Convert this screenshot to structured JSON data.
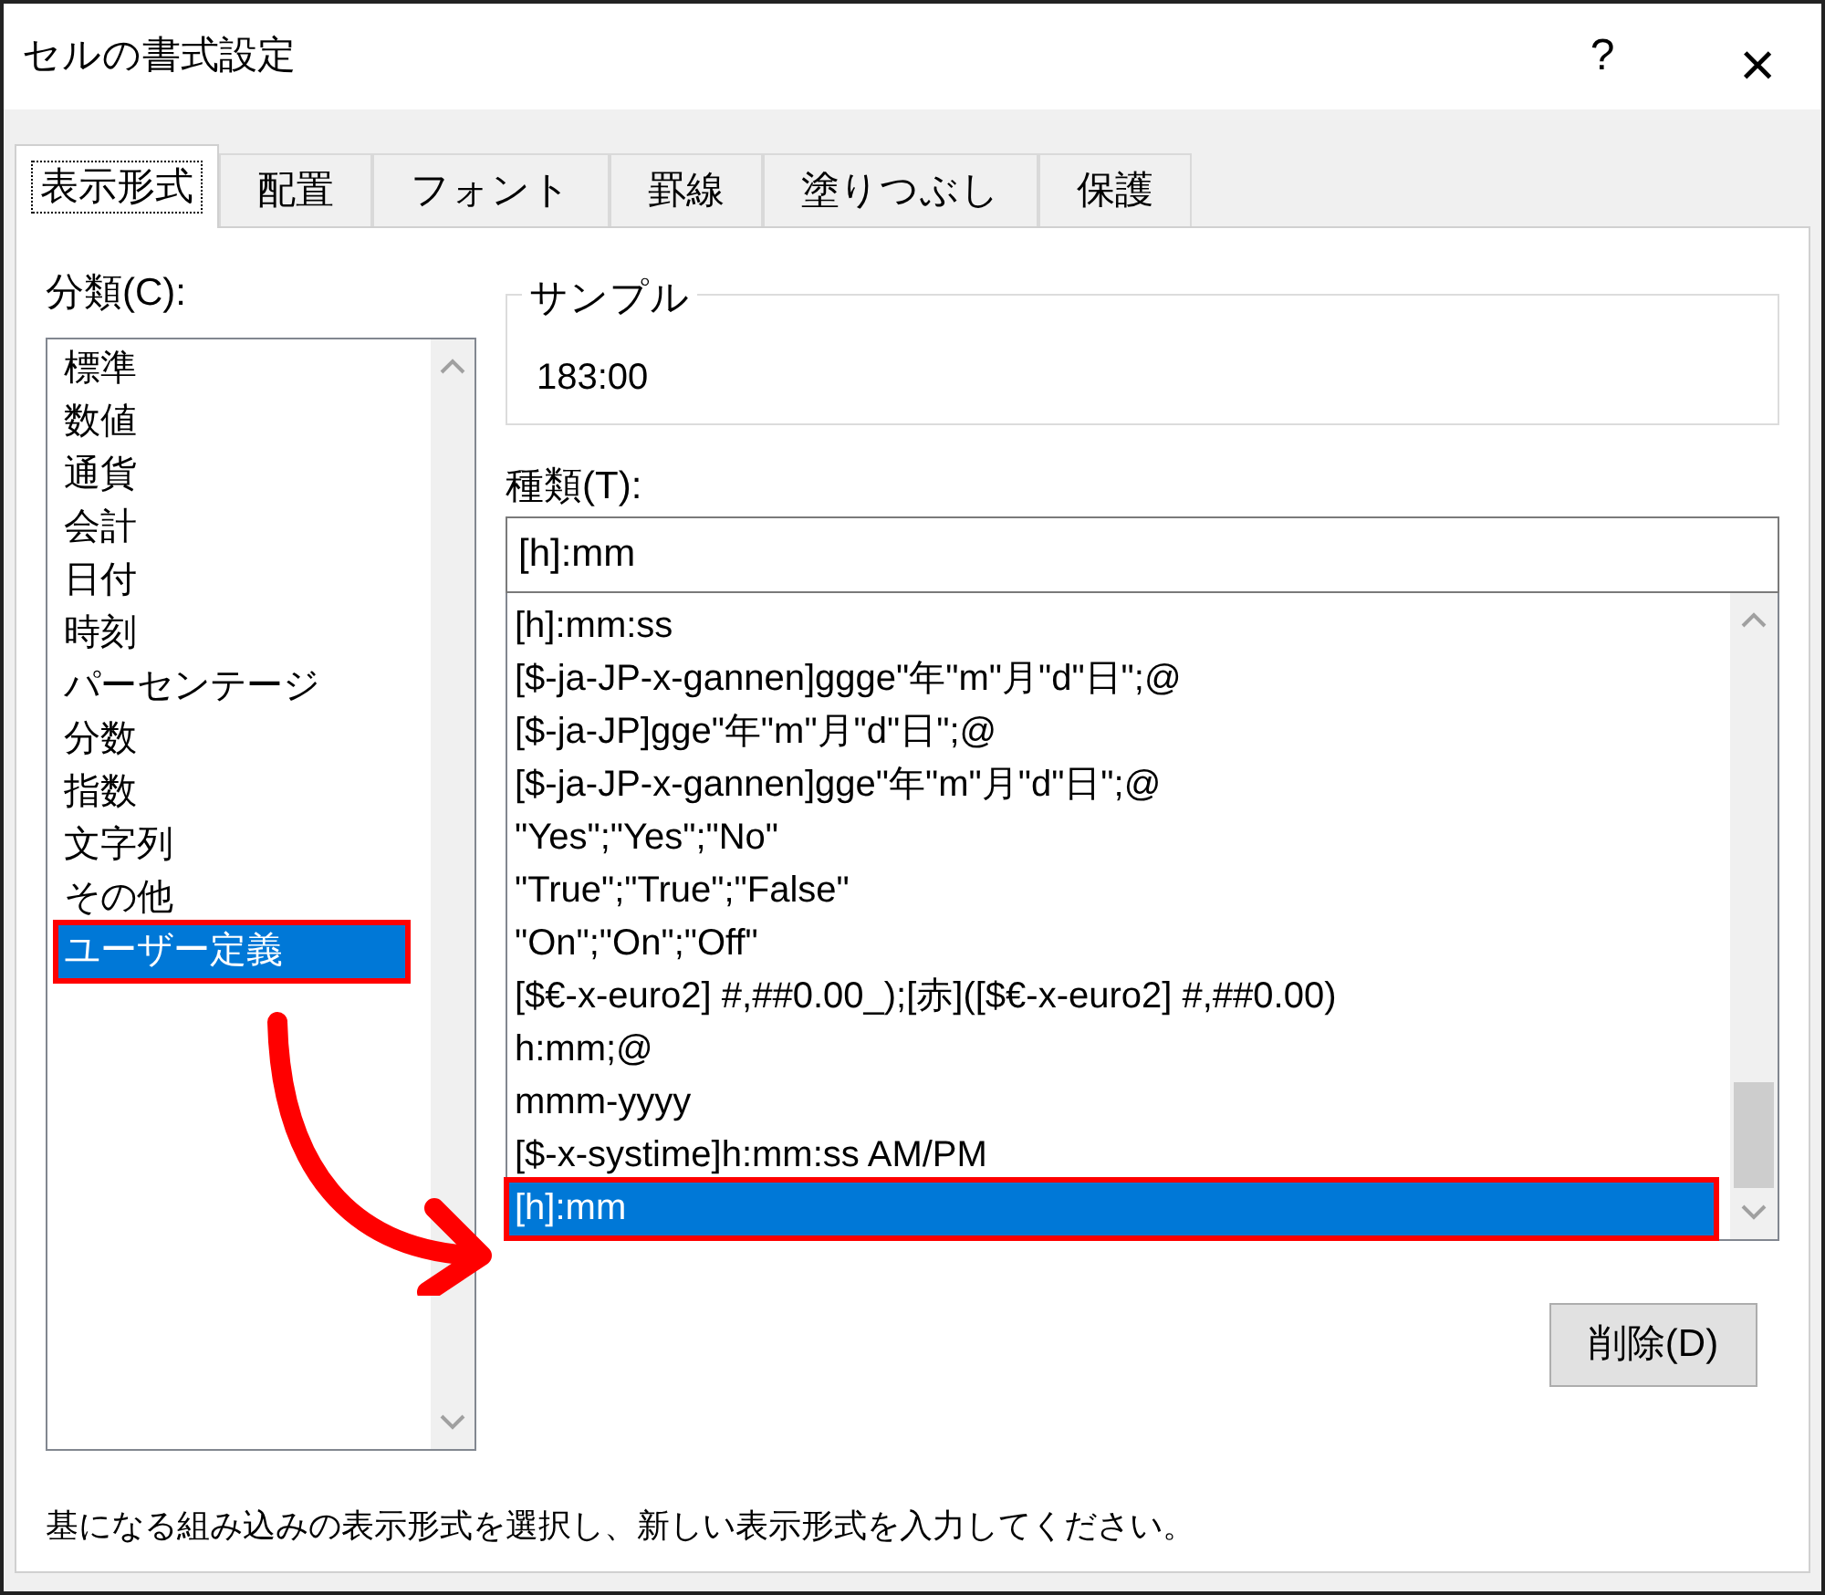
{
  "window": {
    "title": "セルの書式設定",
    "help": "?",
    "close": "×"
  },
  "tabs": [
    {
      "label": "表示形式",
      "selected": true
    },
    {
      "label": "配置",
      "selected": false
    },
    {
      "label": "フォント",
      "selected": false
    },
    {
      "label": "罫線",
      "selected": false
    },
    {
      "label": "塗りつぶし",
      "selected": false
    },
    {
      "label": "保護",
      "selected": false
    }
  ],
  "category": {
    "label": "分類(C):",
    "items": [
      {
        "label": "標準",
        "selected": false,
        "marked": false
      },
      {
        "label": "数値",
        "selected": false,
        "marked": false
      },
      {
        "label": "通貨",
        "selected": false,
        "marked": false
      },
      {
        "label": "会計",
        "selected": false,
        "marked": false
      },
      {
        "label": "日付",
        "selected": false,
        "marked": false
      },
      {
        "label": "時刻",
        "selected": false,
        "marked": false
      },
      {
        "label": "パーセンテージ",
        "selected": false,
        "marked": false
      },
      {
        "label": "分数",
        "selected": false,
        "marked": false
      },
      {
        "label": "指数",
        "selected": false,
        "marked": false
      },
      {
        "label": "文字列",
        "selected": false,
        "marked": false
      },
      {
        "label": "その他",
        "selected": false,
        "marked": false
      },
      {
        "label": "ユーザー定義",
        "selected": true,
        "marked": true
      }
    ]
  },
  "sample": {
    "label": "サンプル",
    "value": "183:00"
  },
  "type": {
    "label": "種類(T):",
    "value": "[h]:mm",
    "items": [
      {
        "label": "[h]:mm:ss",
        "selected": false,
        "marked": false
      },
      {
        "label": "[$-ja-JP-x-gannen]ggge\"年\"m\"月\"d\"日\";@",
        "selected": false,
        "marked": false
      },
      {
        "label": "[$-ja-JP]gge\"年\"m\"月\"d\"日\";@",
        "selected": false,
        "marked": false
      },
      {
        "label": "[$-ja-JP-x-gannen]gge\"年\"m\"月\"d\"日\";@",
        "selected": false,
        "marked": false
      },
      {
        "label": "\"Yes\";\"Yes\";\"No\"",
        "selected": false,
        "marked": false
      },
      {
        "label": "\"True\";\"True\";\"False\"",
        "selected": false,
        "marked": false
      },
      {
        "label": "\"On\";\"On\";\"Off\"",
        "selected": false,
        "marked": false
      },
      {
        "label": "[$€-x-euro2] #,##0.00_);[赤]([$€-x-euro2] #,##0.00)",
        "selected": false,
        "marked": false
      },
      {
        "label": "h:mm;@",
        "selected": false,
        "marked": false
      },
      {
        "label": "mmm-yyyy",
        "selected": false,
        "marked": false
      },
      {
        "label": "[$-x-systime]h:mm:ss AM/PM",
        "selected": false,
        "marked": false
      },
      {
        "label": "[h]:mm",
        "selected": true,
        "marked": true
      }
    ]
  },
  "delete_button": "削除(D)",
  "hint": "基になる組み込みの表示形式を選択し、新しい表示形式を入力してください。"
}
